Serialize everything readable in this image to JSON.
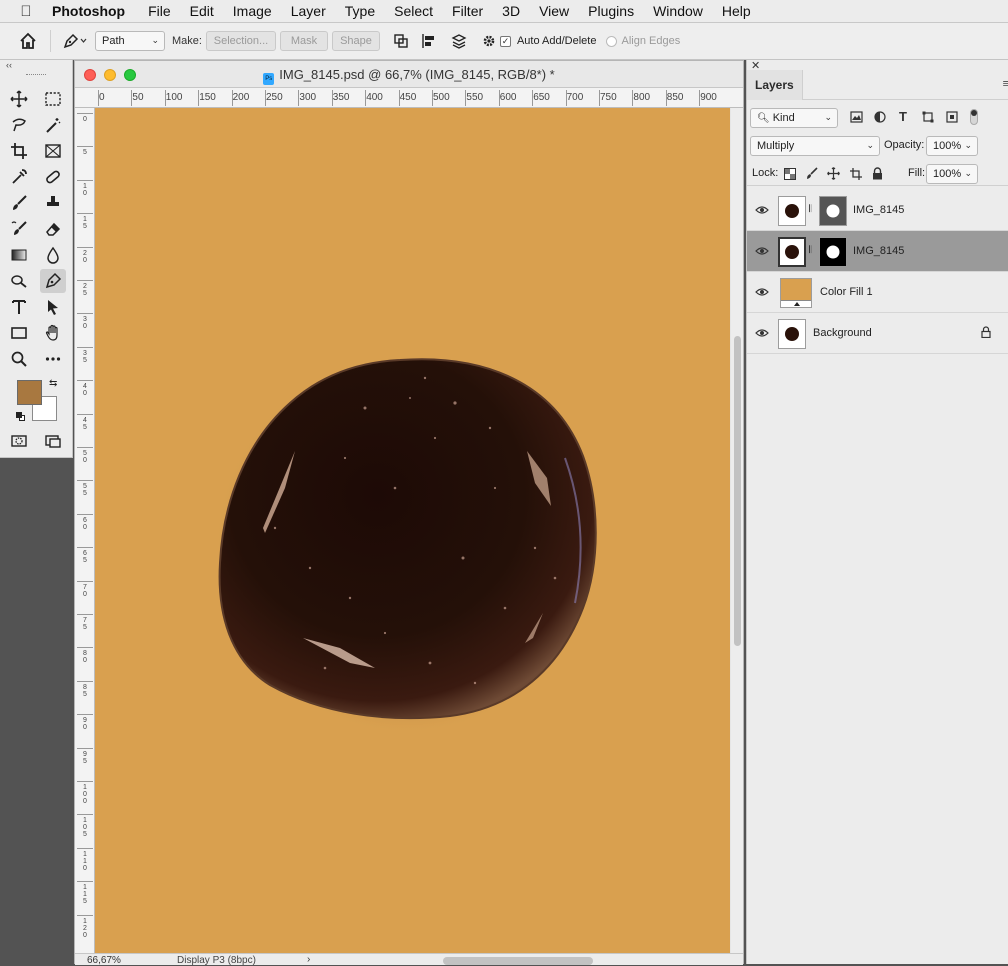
{
  "menubar": {
    "apple": "",
    "app_name": "Photoshop",
    "items": [
      "File",
      "Edit",
      "Image",
      "Layer",
      "Type",
      "Select",
      "Filter",
      "3D",
      "View",
      "Plugins",
      "Window",
      "Help"
    ]
  },
  "options_bar": {
    "mode_select": "Path",
    "make_label": "Make:",
    "selection_button": "Selection...",
    "mask_button": "Mask",
    "shape_button": "Shape",
    "auto_add_delete_label": "Auto Add/Delete",
    "auto_add_delete_checked": true,
    "align_edges_label": "Align Edges",
    "align_edges_checked": false
  },
  "tools": {
    "foreground_color": "#a87840",
    "background_color": "#ffffff",
    "active_tool": "pen-icon"
  },
  "document": {
    "title": "IMG_8145.psd @ 66,7% (IMG_8145, RGB/8*) *",
    "ruler_top_labels": [
      "0",
      "50",
      "100",
      "150",
      "200",
      "250",
      "300",
      "350",
      "400",
      "450",
      "500",
      "550",
      "600",
      "650",
      "700",
      "750",
      "800",
      "850",
      "900"
    ],
    "ruler_left_labels": [
      "0",
      "5",
      "1\n0",
      "1\n5",
      "2\n0",
      "2\n5",
      "3\n0",
      "3\n5",
      "4\n0",
      "4\n5",
      "5\n0",
      "5\n5",
      "6\n0",
      "6\n5",
      "7\n0",
      "7\n5",
      "8\n0",
      "8\n5",
      "9\n0",
      "9\n5",
      "1\n0\n0",
      "1\n0\n5",
      "1\n1\n0",
      "1\n1\n5",
      "1\n2\n0"
    ],
    "canvas_color": "#d9a04f",
    "zoom_status": "66,67%",
    "status_info": "Display P3 (8bpc)"
  },
  "layers_panel": {
    "tab_label": "Layers",
    "kind_filter": "Kind",
    "blend_mode": "Multiply",
    "opacity_label": "Opacity:",
    "opacity_value": "100%",
    "lock_label": "Lock:",
    "fill_label": "Fill:",
    "fill_value": "100%",
    "layers": [
      {
        "name": "IMG_8145",
        "selected": false,
        "has_mask": true,
        "locked": false
      },
      {
        "name": "IMG_8145",
        "selected": true,
        "has_mask": true,
        "locked": false
      },
      {
        "name": "Color Fill 1",
        "selected": false,
        "has_mask": false,
        "locked": false
      },
      {
        "name": "Background",
        "selected": false,
        "has_mask": false,
        "locked": true
      }
    ]
  }
}
